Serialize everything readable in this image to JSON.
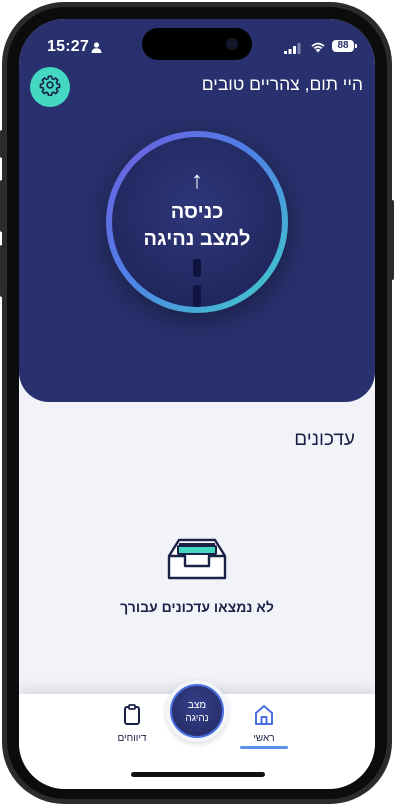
{
  "status_bar": {
    "time": "15:27",
    "battery": "88"
  },
  "header": {
    "greeting": "היי תום, צהריים טובים"
  },
  "drive_button": {
    "line1": "כניסה",
    "line2": "למצב נהיגה"
  },
  "updates": {
    "title": "עדכונים",
    "empty_message": "לא נמצאו עדכונים עבורך"
  },
  "tabbar": {
    "home_label": "ראשי",
    "drive_line1": "מצב",
    "drive_line2": "נהיגה",
    "reports_label": "דיווחים"
  },
  "colors": {
    "primary": "#28306d",
    "accent": "#44d8c3",
    "tab_active": "#5b8fe7"
  },
  "icons": {
    "settings": "gear-icon",
    "home": "home-icon",
    "reports": "clipboard-icon",
    "empty": "inbox-icon"
  }
}
